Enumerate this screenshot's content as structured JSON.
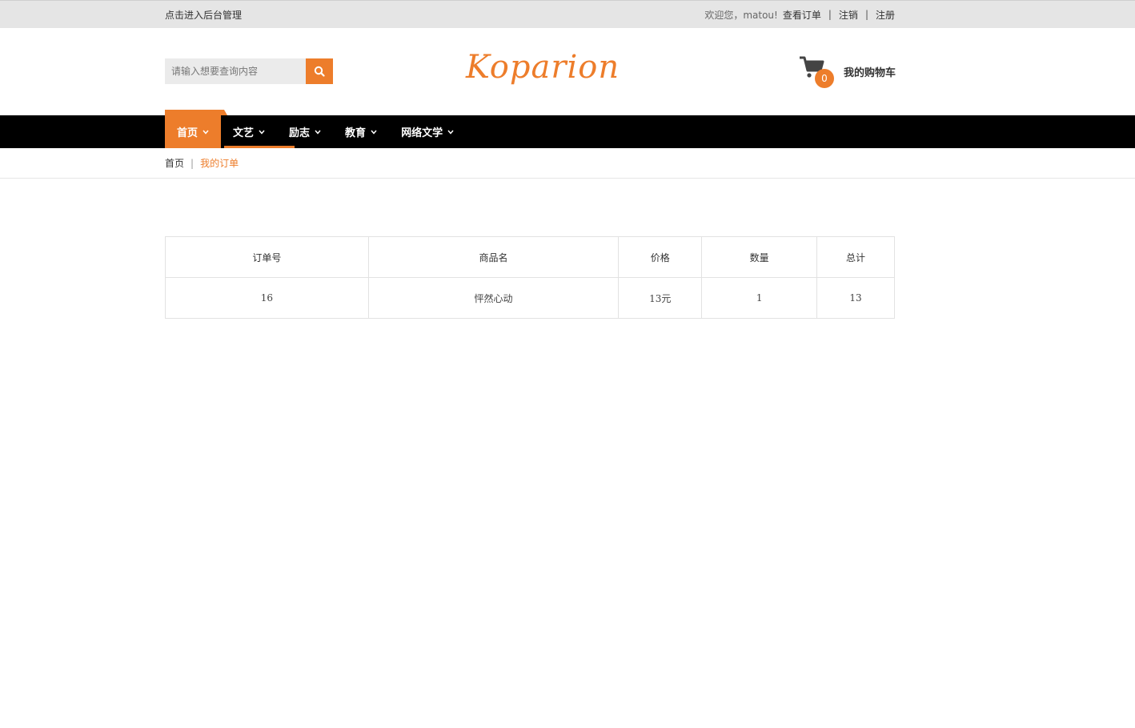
{
  "topbar": {
    "admin_link": "点击进入后台管理",
    "welcome": "欢迎您，matou!",
    "view_orders": "查看订单",
    "logout": "注销",
    "register": "注册",
    "separator": "|"
  },
  "header": {
    "search_placeholder": "请输入想要查询内容",
    "search_icon": "search-icon",
    "logo_text": "Koparion",
    "cart_count": "0",
    "cart_label": "我的购物车"
  },
  "nav": {
    "items": [
      {
        "label": "首页"
      },
      {
        "label": "文艺"
      },
      {
        "label": "励志"
      },
      {
        "label": "教育"
      },
      {
        "label": "网络文学"
      }
    ]
  },
  "breadcrumb": {
    "home": "首页",
    "separator": "|",
    "current": "我的订单"
  },
  "orders": {
    "headers": [
      "订单号",
      "商品名",
      "价格",
      "数量",
      "总计"
    ],
    "rows": [
      {
        "id": "16",
        "name": "怦然心动",
        "price": "13元",
        "qty": "1",
        "total": "13"
      }
    ]
  },
  "colors": {
    "accent": "#ed7d2b",
    "nav_bg": "#000000",
    "topbar_bg": "#e5e5e5"
  }
}
